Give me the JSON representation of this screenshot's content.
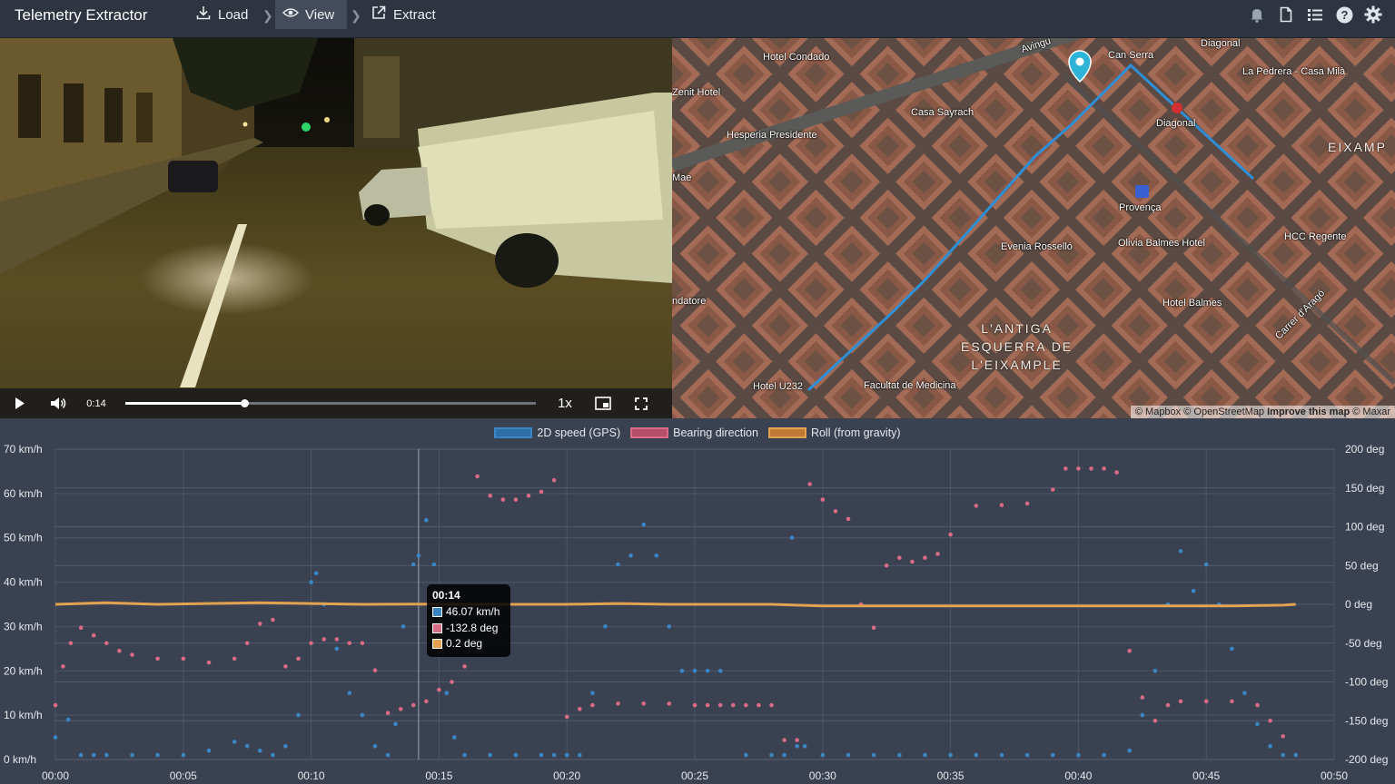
{
  "app": {
    "title": "Telemetry Extractor"
  },
  "toolbar": {
    "load_label": "Load",
    "view_label": "View",
    "extract_label": "Extract",
    "right_icons": [
      "bell-icon",
      "file-icon",
      "list-icon",
      "help-icon",
      "settings-icon"
    ]
  },
  "video": {
    "current_time": "0:14",
    "progress_fraction": 0.29,
    "playback_rate": "1x",
    "icons": [
      "play-icon",
      "volume-icon",
      "picture-in-picture-icon",
      "fullscreen-icon"
    ]
  },
  "map": {
    "labels": [
      {
        "id": "hotel-condado",
        "text": "Hotel Condado"
      },
      {
        "id": "zenit-hotel",
        "text": "Zenit Hotel"
      },
      {
        "id": "casa-sayrach",
        "text": "Casa Sayrach"
      },
      {
        "id": "hesperia",
        "text": "Hesperia Presidente"
      },
      {
        "id": "can-serra",
        "text": "Can Serra"
      },
      {
        "id": "diagonal-top",
        "text": "Diagonal"
      },
      {
        "id": "la-pedrera",
        "text": "La Pedrera - Casa Milà"
      },
      {
        "id": "diagonal-metro",
        "text": "Diagonal"
      },
      {
        "id": "mae",
        "text": "Mae"
      },
      {
        "id": "provenca",
        "text": "Provença"
      },
      {
        "id": "evenia",
        "text": "Evenia Rosselló"
      },
      {
        "id": "olivia",
        "text": "Olivia Balmes Hotel"
      },
      {
        "id": "hcc",
        "text": "HCC Regente"
      },
      {
        "id": "hotel-balmes",
        "text": "Hotel Balmes"
      },
      {
        "id": "ndatore",
        "text": "ndatore"
      },
      {
        "id": "hotel-u232",
        "text": "Hotel U232"
      },
      {
        "id": "facultat",
        "text": "Facultat de Medicina"
      },
      {
        "id": "carrer-arago",
        "text": "Carrer d'Aragó"
      },
      {
        "id": "avinguda",
        "text": "Avingu"
      }
    ],
    "district_eixample": "EIXAMP",
    "district_antiga": "L'ANTIGA\nESQUERRA DE\nL'EIXAMPLE",
    "attribution": {
      "mapbox": "© Mapbox",
      "osm": "© OpenStreetMap",
      "improve": "Improve this map",
      "maxar": "© Maxar"
    }
  },
  "colors": {
    "speed": "#3a86c4",
    "bearing": "#d96b86",
    "roll": "#e3a24f",
    "speed_legend_fill": "#2e6fa8",
    "bearing_legend_fill": "#b54f69",
    "roll_legend_fill": "#c07a35"
  },
  "tooltip": {
    "time": "00:14",
    "rows": [
      {
        "series": "speed",
        "text": "46.07 km/h"
      },
      {
        "series": "bearing",
        "text": "-132.8 deg"
      },
      {
        "series": "roll",
        "text": "0.2 deg"
      }
    ]
  },
  "chart_data": {
    "type": "scatter",
    "legend": [
      "2D speed (GPS)",
      "Bearing direction",
      "Roll (from gravity)"
    ],
    "legend_position": "top-center",
    "x_tick_labels": [
      "00:00",
      "00:05",
      "00:10",
      "00:15",
      "00:20",
      "00:25",
      "00:30",
      "00:35",
      "00:40",
      "00:45",
      "00:50"
    ],
    "y_left_tick_labels": [
      "70 km/h",
      "60 km/h",
      "50 km/h",
      "40 km/h",
      "30 km/h",
      "20 km/h",
      "10 km/h",
      "0 km/h"
    ],
    "y_right_tick_labels": [
      "200 deg",
      "150 deg",
      "100 deg",
      "50 deg",
      "0 deg",
      "-50 deg",
      "-100 deg",
      "-150 deg",
      "-200 deg"
    ],
    "xlim": [
      0,
      50
    ],
    "ylim_left": [
      0,
      70
    ],
    "ylim_right": [
      -200,
      200
    ],
    "grid": true,
    "cursor_x": 14.2,
    "series": [
      {
        "name": "2D speed (GPS)",
        "axis": "left",
        "x": [
          0,
          0.5,
          1,
          1.5,
          2,
          3,
          4,
          5,
          6,
          7,
          7.5,
          8,
          8.5,
          9,
          9.5,
          10,
          10.2,
          10.5,
          11,
          11.5,
          12,
          12.5,
          13,
          13.3,
          13.6,
          14,
          14.2,
          14.5,
          14.8,
          15,
          15.3,
          15.6,
          16,
          17,
          18,
          19,
          19.5,
          20,
          20.5,
          21,
          21.5,
          22,
          22.5,
          23,
          23.5,
          24,
          24.5,
          25,
          25.5,
          26,
          27,
          28,
          28.5,
          28.8,
          29,
          29.3,
          30,
          31,
          32,
          33,
          34,
          35,
          36,
          37,
          38,
          39,
          40,
          41,
          42,
          42.5,
          43,
          43.5,
          44,
          44.5,
          45,
          45.5,
          46,
          46.5,
          47,
          47.5,
          48,
          48.5
        ],
        "y": [
          5,
          9,
          1,
          1,
          1,
          1,
          1,
          1,
          2,
          4,
          3,
          2,
          1,
          3,
          10,
          40,
          42,
          35,
          25,
          15,
          10,
          3,
          1,
          8,
          30,
          44,
          46,
          54,
          44,
          30,
          15,
          5,
          1,
          1,
          1,
          1,
          1,
          1,
          1,
          15,
          30,
          44,
          46,
          53,
          46,
          30,
          20,
          20,
          20,
          20,
          1,
          1,
          1,
          50,
          3,
          3,
          1,
          1,
          1,
          1,
          1,
          1,
          1,
          1,
          1,
          1,
          1,
          1,
          2,
          10,
          20,
          35,
          47,
          38,
          44,
          35,
          25,
          15,
          8,
          3,
          1,
          1
        ]
      },
      {
        "name": "Bearing direction",
        "axis": "right",
        "x": [
          0,
          0.3,
          0.6,
          1,
          1.5,
          2,
          2.5,
          3,
          4,
          5,
          6,
          7,
          7.5,
          8,
          8.5,
          9,
          9.5,
          10,
          10.5,
          11,
          11.5,
          12,
          12.5,
          13,
          13.5,
          14,
          14.5,
          15,
          15.5,
          16,
          16.5,
          17,
          17.5,
          18,
          18.5,
          19,
          19.5,
          20,
          20.5,
          21,
          22,
          23,
          24,
          25,
          25.5,
          26,
          26.5,
          27,
          27.5,
          28,
          28.5,
          29,
          29.5,
          30,
          30.5,
          31,
          31.5,
          32,
          32.5,
          33,
          33.5,
          34,
          34.5,
          35,
          36,
          37,
          38,
          39,
          39.5,
          40,
          40.5,
          41,
          41.5,
          42,
          42.5,
          43,
          43.5,
          44,
          45,
          46,
          47,
          47.5,
          48
        ],
        "y": [
          -130,
          -80,
          -50,
          -30,
          -40,
          -50,
          -60,
          -65,
          -70,
          -70,
          -75,
          -70,
          -50,
          -25,
          -20,
          -80,
          -70,
          -50,
          -45,
          -45,
          -50,
          -50,
          -85,
          -140,
          -135,
          -130,
          -125,
          -110,
          -100,
          -80,
          165,
          140,
          135,
          135,
          140,
          145,
          160,
          -145,
          -135,
          -130,
          -128,
          -128,
          -128,
          -130,
          -130,
          -130,
          -130,
          -130,
          -130,
          -130,
          -175,
          -175,
          155,
          135,
          120,
          110,
          0,
          -30,
          50,
          60,
          55,
          60,
          65,
          90,
          127,
          128,
          130,
          148,
          175,
          175,
          175,
          175,
          170,
          -60,
          -120,
          -150,
          -130,
          -125,
          -125,
          -125,
          -130,
          -150,
          -170
        ]
      },
      {
        "name": "Roll (from gravity)",
        "axis": "right",
        "x": [
          0,
          2,
          4,
          6,
          8,
          10,
          12,
          14,
          16,
          18,
          20,
          22,
          24,
          26,
          28,
          30,
          32,
          34,
          36,
          38,
          40,
          42,
          44,
          46,
          48,
          48.5
        ],
        "y": [
          0,
          2,
          0,
          1,
          2,
          1,
          0,
          0.2,
          0,
          0,
          0,
          1,
          0,
          0,
          0,
          -2,
          -2,
          -2,
          -2,
          -2,
          -2,
          -2,
          -2,
          -2,
          -1,
          0
        ]
      }
    ]
  }
}
